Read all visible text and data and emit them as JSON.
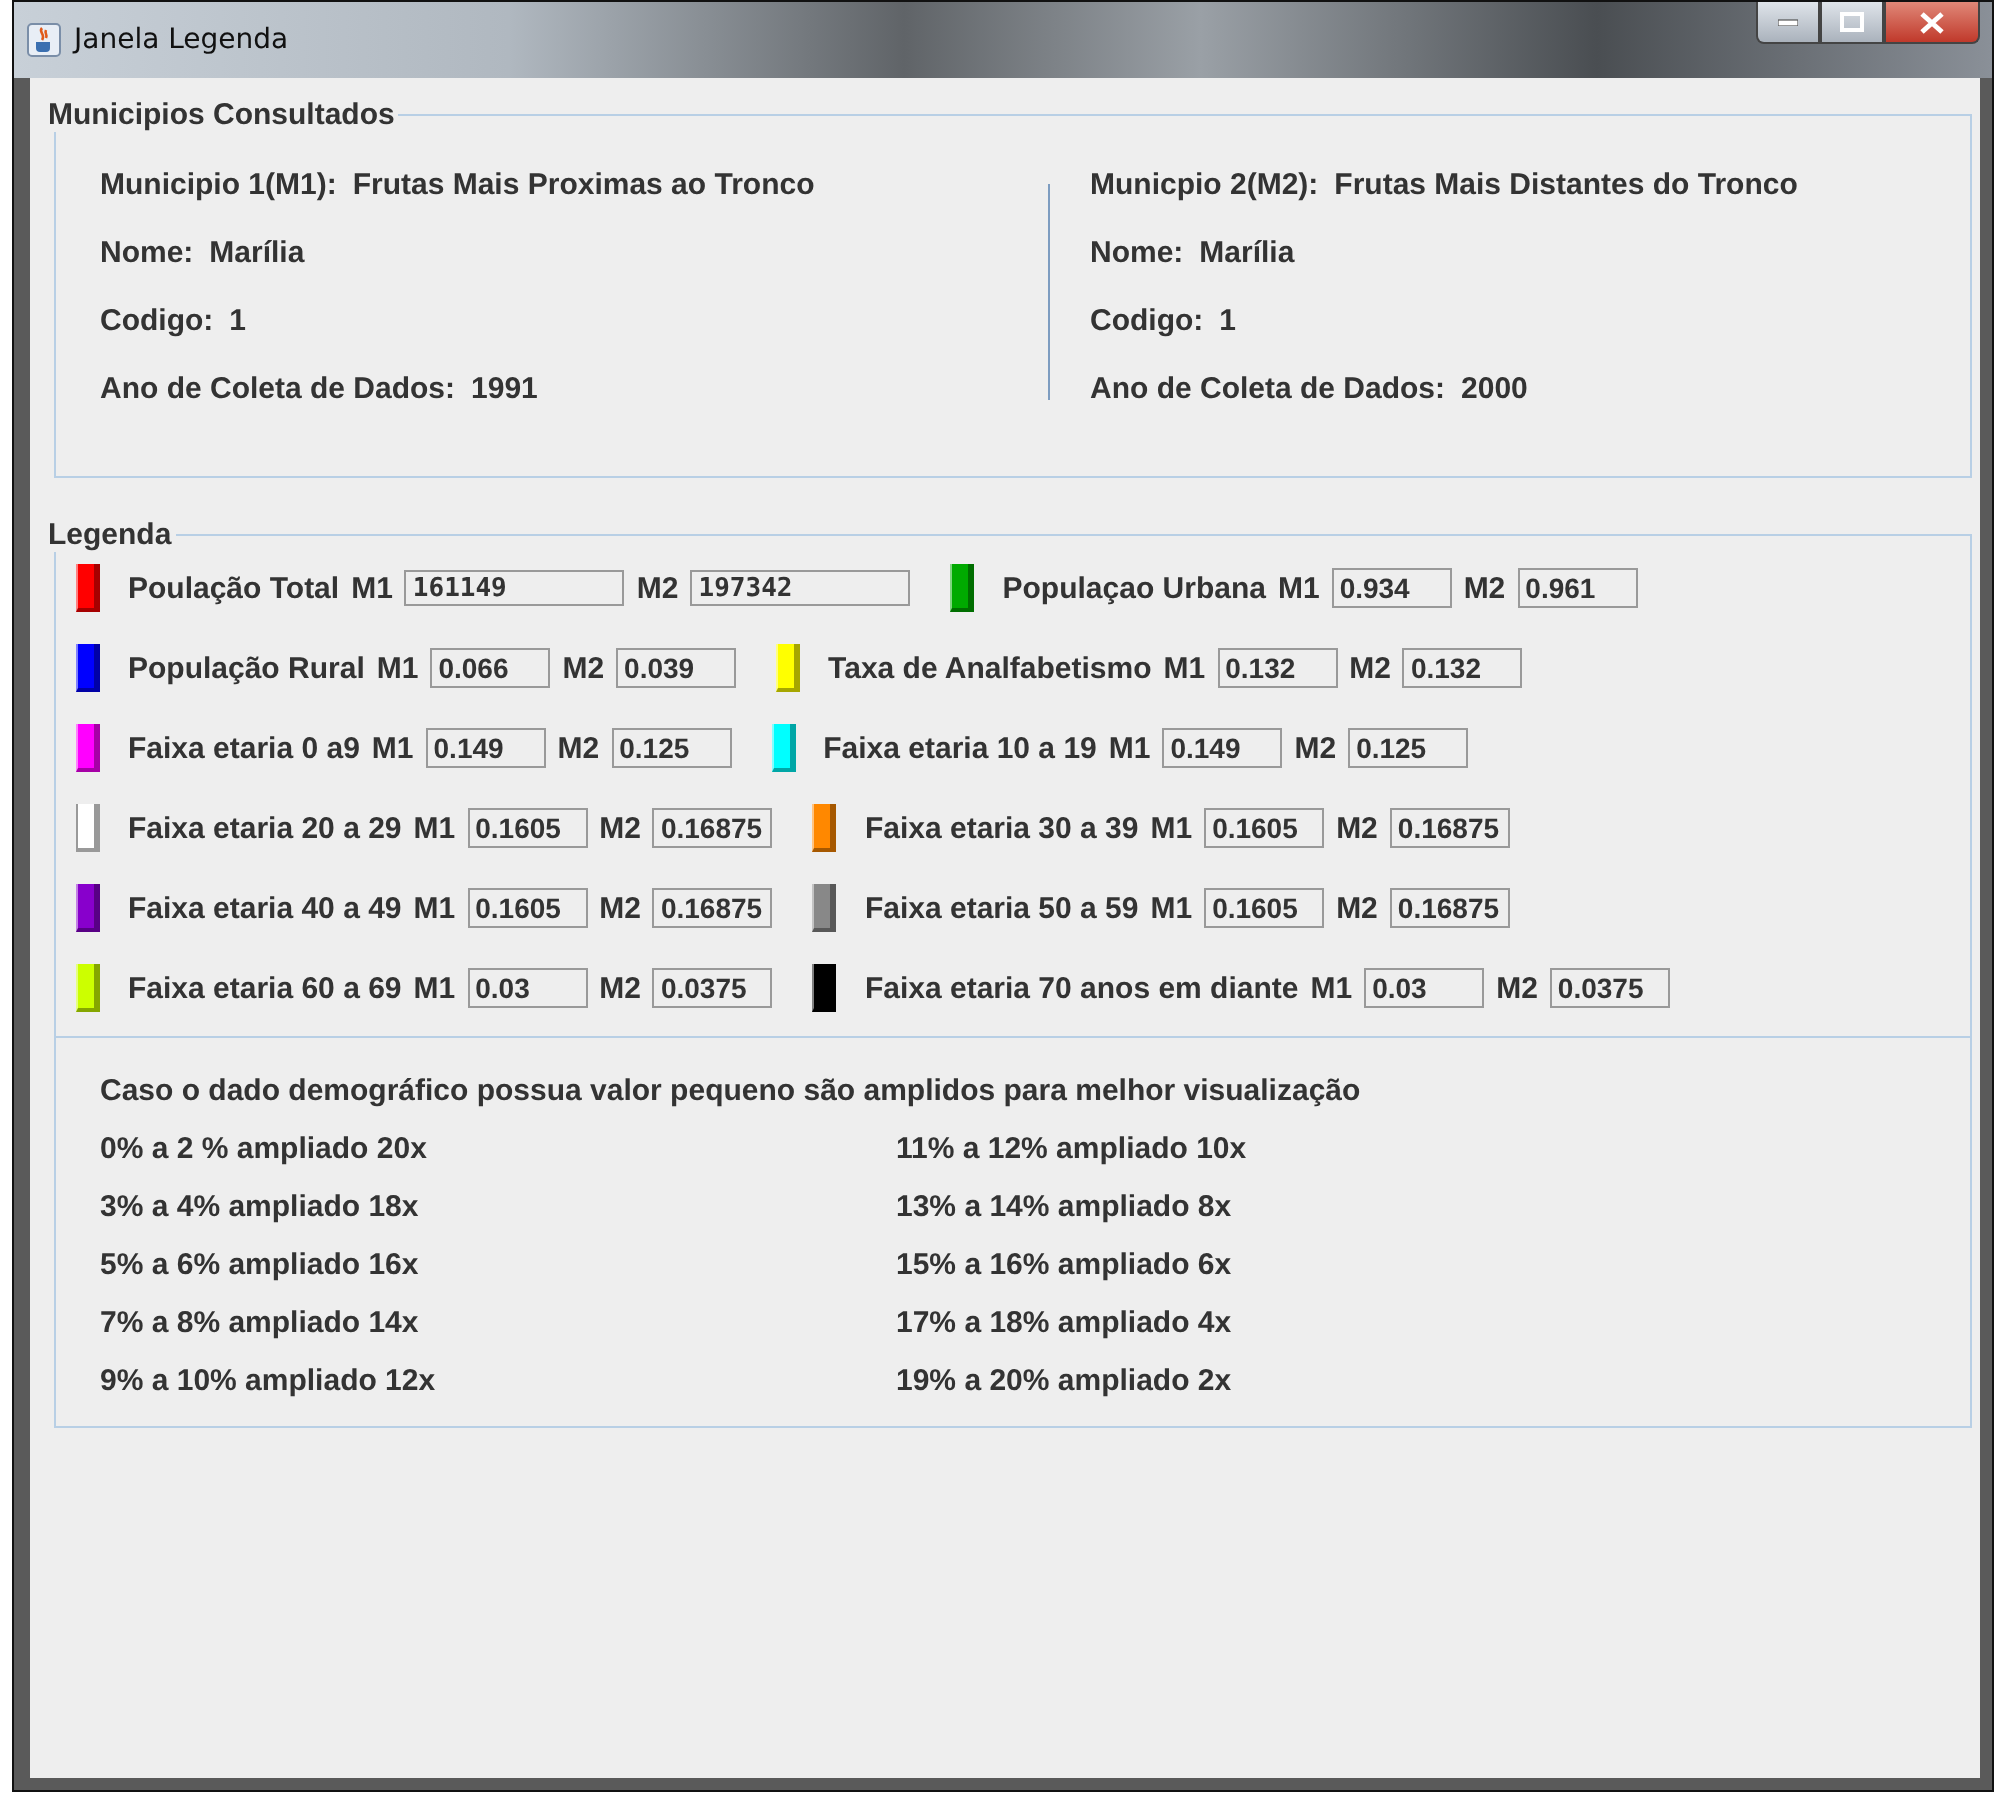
{
  "window": {
    "title": "Janela Legenda"
  },
  "municipios": {
    "title": "Municipios Consultados",
    "columns": [
      {
        "lines": [
          {
            "label": "Municipio 1(M1):",
            "value": "Frutas Mais Proximas ao Tronco"
          },
          {
            "label": "Nome:",
            "value": "Marília"
          },
          {
            "label": "Codigo:",
            "value": "1"
          },
          {
            "label": "Ano de Coleta de Dados:",
            "value": "1991"
          }
        ]
      },
      {
        "lines": [
          {
            "label": "Municpio 2(M2):",
            "value": "Frutas Mais Distantes do Tronco"
          },
          {
            "label": "Nome:",
            "value": "Marília"
          },
          {
            "label": "Codigo:",
            "value": "1"
          },
          {
            "label": "Ano de Coleta de Dados:",
            "value": "2000"
          }
        ]
      }
    ]
  },
  "legenda": {
    "title": "Legenda",
    "rows": [
      [
        {
          "color": "#ff0000",
          "label": "Poulação Total",
          "m1_label": "M1",
          "m1": "161149",
          "m2_label": "M2",
          "m2": "197342",
          "kind": "wide"
        },
        {
          "color": "#00aa00",
          "label": "Populaçao Urbana",
          "m1_label": "M1",
          "m1": "0.934",
          "m2_label": "M2",
          "m2": "0.961",
          "kind": "normal"
        }
      ],
      [
        {
          "color": "#0000ff",
          "label": "População Rural",
          "m1_label": "M1",
          "m1": "0.066",
          "m2_label": "M2",
          "m2": "0.039",
          "kind": "normal"
        },
        {
          "color": "#ffff00",
          "label": "Taxa de Analfabetismo",
          "m1_label": "M1",
          "m1": "0.132",
          "m2_label": "M2",
          "m2": "0.132",
          "kind": "normal"
        }
      ],
      [
        {
          "color": "#ff00ff",
          "label": "Faixa etaria 0 a9",
          "m1_label": "M1",
          "m1": "0.149",
          "m2_label": "M2",
          "m2": "0.125",
          "kind": "normal"
        },
        {
          "color": "#00ffff",
          "label": "Faixa  etaria 10 a 19",
          "m1_label": "M1",
          "m1": "0.149",
          "m2_label": "M2",
          "m2": "0.125",
          "kind": "normal"
        }
      ],
      [
        {
          "color": "#ffffff",
          "label": "Faixa etaria 20 a 29",
          "m1_label": "M1",
          "m1": "0.1605",
          "m2_label": "M2",
          "m2": "0.16875",
          "kind": "normal"
        },
        {
          "color": "#ff8800",
          "label": "Faixa etaria 30 a 39",
          "m1_label": "M1",
          "m1": "0.1605",
          "m2_label": "M2",
          "m2": "0.16875",
          "kind": "normal"
        }
      ],
      [
        {
          "color": "#8800cc",
          "label": "Faixa etaria 40 a 49",
          "m1_label": "M1",
          "m1": "0.1605",
          "m2_label": "M2",
          "m2": "0.16875",
          "kind": "normal"
        },
        {
          "color": "#888888",
          "label": "Faixa etaria 50 a 59",
          "m1_label": "M1",
          "m1": "0.1605",
          "m2_label": "M2",
          "m2": "0.16875",
          "kind": "normal"
        }
      ],
      [
        {
          "color": "#ccff00",
          "label": "Faixa etaria 60 a 69",
          "m1_label": "M1",
          "m1": "0.03",
          "m2_label": "M2",
          "m2": "0.0375",
          "kind": "normal"
        },
        {
          "color": "#000000",
          "label": "Faixa etaria 70 anos em diante",
          "m1_label": "M1",
          "m1": "0.03",
          "m2_label": "M2",
          "m2": "0.0375",
          "kind": "normal"
        }
      ]
    ]
  },
  "ampliacao": {
    "note": "Caso o dado demográfico possua valor pequeno são amplidos para melhor visualização",
    "left": [
      "0% a 2 % ampliado 20x",
      "3% a 4% ampliado 18x",
      "5% a 6% ampliado 16x",
      "7% a 8% ampliado 14x",
      "9% a 10% ampliado 12x"
    ],
    "right": [
      "11% a 12% ampliado 10x",
      "13% a 14% ampliado 8x",
      "15% a 16% ampliado 6x",
      "17% a 18% ampliado 4x",
      "19% a 20% ampliado 2x"
    ]
  }
}
